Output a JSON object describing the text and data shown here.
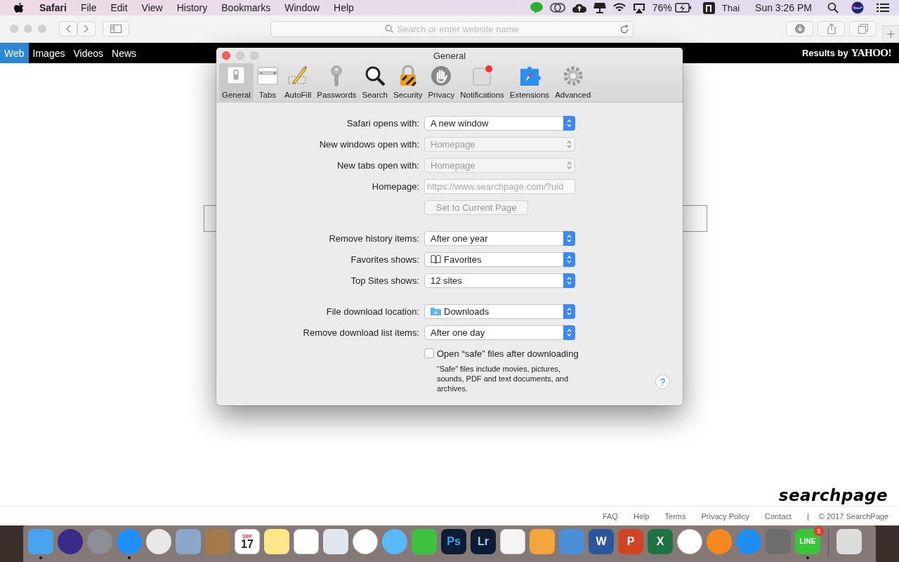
{
  "menu_bar": {
    "app": "Safari",
    "menus": [
      "File",
      "Edit",
      "View",
      "History",
      "Bookmarks",
      "Window",
      "Help"
    ],
    "battery": "76%",
    "input_source": "Thai",
    "clock": "Sun 3:26 PM"
  },
  "toolbar": {
    "address_placeholder": "Search or enter website name"
  },
  "search_nav": {
    "tabs": [
      {
        "label": "Web",
        "selected": true
      },
      {
        "label": "Images",
        "selected": false
      },
      {
        "label": "Videos",
        "selected": false
      },
      {
        "label": "News",
        "selected": false
      }
    ],
    "credit": "Results by",
    "provider": "YAHOO!"
  },
  "page": {
    "logo": "searchpage",
    "footer_links": [
      "FAQ",
      "Help",
      "Terms",
      "Privacy Policy",
      "Contact"
    ],
    "separator": "|",
    "copyright": "© 2017 SearchPage"
  },
  "dialog": {
    "title": "General",
    "tabs": [
      {
        "label": "General",
        "selected": true
      },
      {
        "label": "Tabs",
        "selected": false
      },
      {
        "label": "AutoFill",
        "selected": false
      },
      {
        "label": "Passwords",
        "selected": false
      },
      {
        "label": "Search",
        "selected": false
      },
      {
        "label": "Security",
        "selected": false
      },
      {
        "label": "Privacy",
        "selected": false
      },
      {
        "label": "Notifications",
        "selected": false
      },
      {
        "label": "Extensions",
        "selected": false
      },
      {
        "label": "Advanced",
        "selected": false
      }
    ],
    "groups": [
      [
        {
          "kind": "select",
          "label": "Safari opens with:",
          "value": "A new window",
          "disabled": false
        },
        {
          "kind": "select",
          "label": "New windows open with:",
          "value": "Homepage",
          "disabled": true
        },
        {
          "kind": "select",
          "label": "New tabs open with:",
          "value": "Homepage",
          "disabled": true
        },
        {
          "kind": "field",
          "label": "Homepage:",
          "value": "https://www.searchpage.com/?uid",
          "disabled": true
        },
        {
          "kind": "button",
          "value": "Set to Current Page",
          "disabled": true
        }
      ],
      [
        {
          "kind": "select",
          "label": "Remove history items:",
          "value": "After one year",
          "disabled": false
        },
        {
          "kind": "book_select",
          "label": "Favorites shows:",
          "value": "Favorites",
          "disabled": false
        },
        {
          "kind": "select",
          "label": "Top Sites shows:",
          "value": "12 sites",
          "disabled": false
        }
      ],
      [
        {
          "kind": "folder_select",
          "label": "File download location:",
          "value": "Downloads",
          "disabled": false
        },
        {
          "kind": "select",
          "label": "Remove download list items:",
          "value": "After one day",
          "disabled": false
        }
      ]
    ],
    "checkbox": {
      "label": "Open “safe” files after downloading",
      "checked": false,
      "note": "“Safe” files include movies, pictures, sounds, PDF and text documents, and archives."
    },
    "help": "?"
  },
  "dock": [
    {
      "running": true
    },
    {
      "running": false
    },
    {
      "running": false
    },
    {
      "running": true
    },
    {
      "running": false
    },
    {
      "running": false
    },
    {
      "running": false
    },
    {
      "running": false,
      "caption": "SEP",
      "glyph": "17"
    },
    {
      "running": false
    },
    {
      "running": false
    },
    {
      "running": false
    },
    {
      "running": false
    },
    {
      "running": false
    },
    {
      "running": false
    },
    {
      "running": false,
      "glyph": "Ps"
    },
    {
      "running": false,
      "glyph": "Lr"
    },
    {
      "running": false
    },
    {
      "running": false
    },
    {
      "running": false
    },
    {
      "running": false,
      "glyph": "W"
    },
    {
      "running": false,
      "glyph": "P"
    },
    {
      "running": false,
      "glyph": "X"
    },
    {
      "running": false
    },
    {
      "running": false
    },
    {
      "running": false
    },
    {
      "running": false
    },
    {
      "running": true,
      "glyph": "LINE",
      "badge": "5"
    },
    {
      "running": false
    }
  ]
}
